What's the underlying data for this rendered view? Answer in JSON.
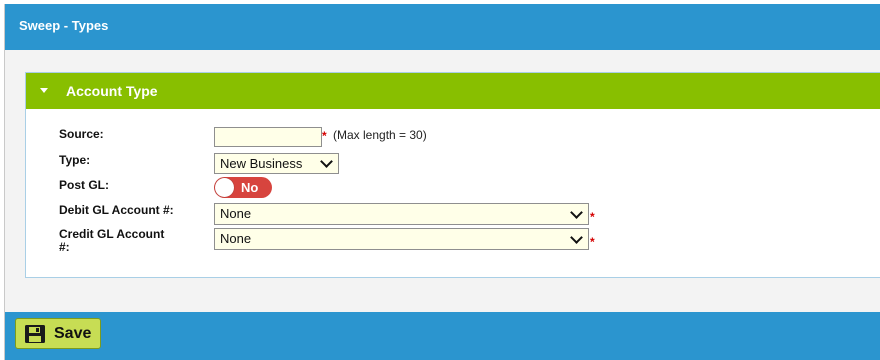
{
  "header": {
    "title": "Sweep - Types"
  },
  "panel": {
    "title": "Account Type"
  },
  "form": {
    "source": {
      "label": "Source:",
      "value": "",
      "required_mark": "*",
      "hint": "(Max length = 30)"
    },
    "type": {
      "label": "Type:",
      "value": "New Business"
    },
    "post_gl": {
      "label": "Post GL:",
      "state": "No"
    },
    "debit": {
      "label": "Debit GL Account #:",
      "value": "None",
      "required_mark": "*"
    },
    "credit": {
      "label_line1": "Credit GL Account",
      "label_line2": "#:",
      "value": "None",
      "required_mark": "*"
    }
  },
  "footer": {
    "save_label": "Save"
  },
  "colors": {
    "header": "#2b95cf",
    "panel_header": "#88bf00",
    "save_button": "#c7dd54",
    "toggle_off": "#d7443e",
    "required": "#d40000",
    "input_bg": "#ffffe8"
  },
  "icons": {
    "panel_toggle": "caret-down-icon",
    "save": "floppy-disk-icon",
    "select": "chevron-down-icon"
  }
}
